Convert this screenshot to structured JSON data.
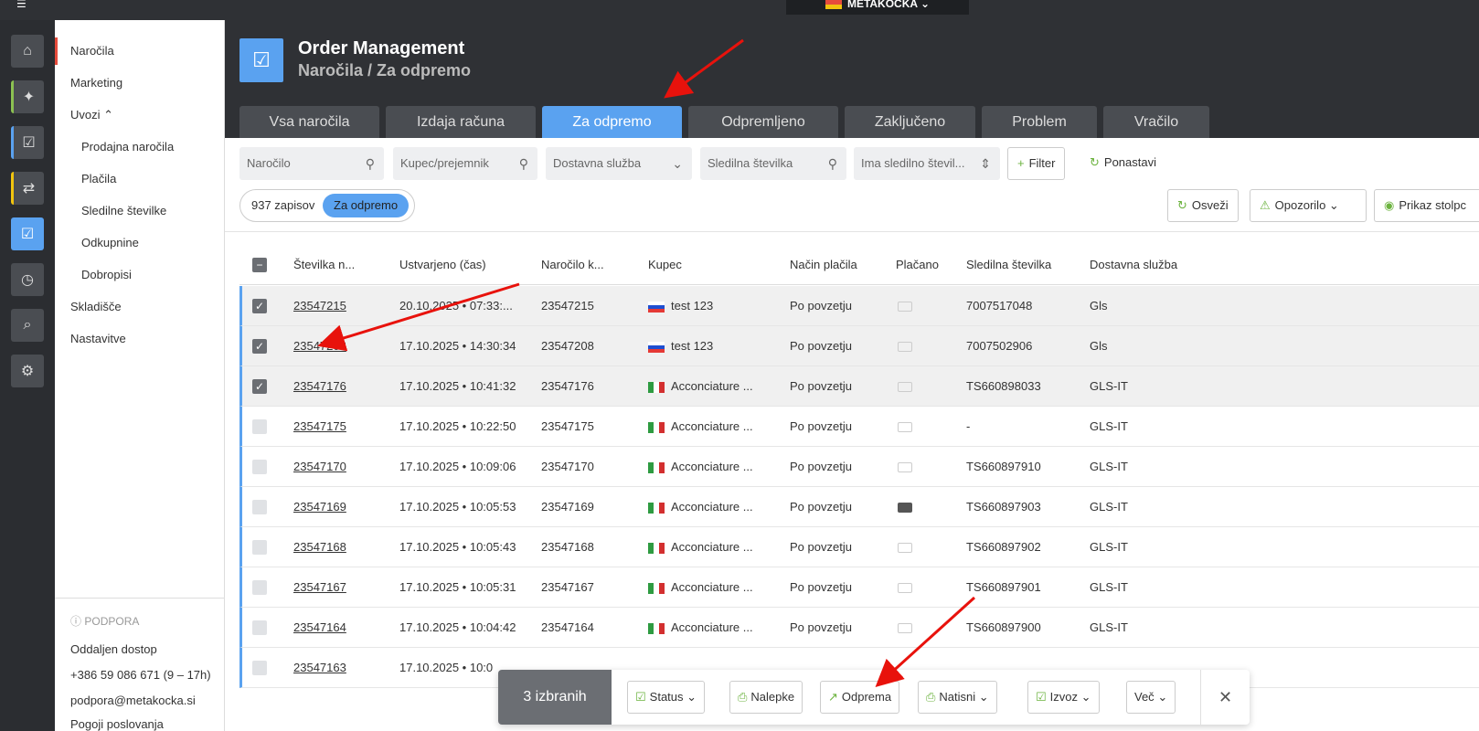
{
  "brand": {
    "name": "METAKOCKA"
  },
  "nav": {
    "items": [
      {
        "label": "Naročila"
      },
      {
        "label": "Marketing"
      },
      {
        "label": "Uvozi"
      },
      {
        "label": "Prodajna naročila"
      },
      {
        "label": "Plačila"
      },
      {
        "label": "Sledilne številke"
      },
      {
        "label": "Odkupnine"
      },
      {
        "label": "Dobropisi"
      },
      {
        "label": "Skladišče"
      },
      {
        "label": "Nastavitve"
      }
    ],
    "support_title": "PODPORA",
    "support_lines": [
      "Oddaljen dostop",
      "+386 59 086 671 (9 – 17h)",
      "podpora@metakocka.si",
      "Pogoji poslovanja"
    ]
  },
  "header": {
    "title": "Order Management",
    "breadcrumb": "Naročila / Za odpremo"
  },
  "tabs": [
    {
      "label": "Vsa naročila"
    },
    {
      "label": "Izdaja računa"
    },
    {
      "label": "Za odpremo"
    },
    {
      "label": "Odpremljeno"
    },
    {
      "label": "Zaključeno"
    },
    {
      "label": "Problem"
    },
    {
      "label": "Vračilo"
    }
  ],
  "filters": {
    "order_placeholder": "Naročilo",
    "buyer_placeholder": "Kupec/prejemnik",
    "delivery_placeholder": "Dostavna služba",
    "tracking_placeholder": "Sledilna številka",
    "has_tracking_placeholder": "Ima sledilno števil...",
    "filter_label": "Filter",
    "reset_label": "Ponastavi"
  },
  "summary": {
    "count": "937 zapisov",
    "badge": "Za odpremo"
  },
  "actions": {
    "refresh": "Osveži",
    "warning": "Opozorilo",
    "columns": "Prikaz stolpc"
  },
  "table": {
    "headers": [
      "Številka n...",
      "Ustvarjeno (čas)",
      "Naročilo k...",
      "Kupec",
      "Način plačila",
      "Plačano",
      "Sledilna številka",
      "Dostavna služba"
    ],
    "rows": [
      {
        "number": "23547215",
        "created": "20.10.2025 • 07:33:...",
        "order": "23547215",
        "buyer": "test 123",
        "payment": "Po povzetju",
        "tracking": "7007517048",
        "delivery": "Gls"
      },
      {
        "number": "23547208",
        "created": "17.10.2025 • 14:30:34",
        "order": "23547208",
        "buyer": "test 123",
        "payment": "Po povzetju",
        "tracking": "7007502906",
        "delivery": "Gls"
      },
      {
        "number": "23547176",
        "created": "17.10.2025 • 10:41:32",
        "order": "23547176",
        "buyer": "Acconciature ...",
        "payment": "Po povzetju",
        "tracking": "TS660898033",
        "delivery": "GLS-IT"
      },
      {
        "number": "23547175",
        "created": "17.10.2025 • 10:22:50",
        "order": "23547175",
        "buyer": "Acconciature ...",
        "payment": "Po povzetju",
        "tracking": "-",
        "delivery": "GLS-IT"
      },
      {
        "number": "23547170",
        "created": "17.10.2025 • 10:09:06",
        "order": "23547170",
        "buyer": "Acconciature ...",
        "payment": "Po povzetju",
        "tracking": "TS660897910",
        "delivery": "GLS-IT"
      },
      {
        "number": "23547169",
        "created": "17.10.2025 • 10:05:53",
        "order": "23547169",
        "buyer": "Acconciature ...",
        "payment": "Po povzetju",
        "tracking": "TS660897903",
        "delivery": "GLS-IT"
      },
      {
        "number": "23547168",
        "created": "17.10.2025 • 10:05:43",
        "order": "23547168",
        "buyer": "Acconciature ...",
        "payment": "Po povzetju",
        "tracking": "TS660897902",
        "delivery": "GLS-IT"
      },
      {
        "number": "23547167",
        "created": "17.10.2025 • 10:05:31",
        "order": "23547167",
        "buyer": "Acconciature ...",
        "payment": "Po povzetju",
        "tracking": "TS660897901",
        "delivery": "GLS-IT"
      },
      {
        "number": "23547164",
        "created": "17.10.2025 • 10:04:42",
        "order": "23547164",
        "buyer": "Acconciature ...",
        "payment": "Po povzetju",
        "tracking": "TS660897900",
        "delivery": "GLS-IT"
      },
      {
        "number": "23547163",
        "created": "17.10.2025 • 10:0",
        "order": "",
        "buyer": "",
        "payment": "",
        "tracking": "",
        "delivery": ""
      }
    ]
  },
  "bulk": {
    "selected": "3 izbranih",
    "status": "Status",
    "labels": "Nalepke",
    "shipping": "Odprema",
    "print": "Natisni",
    "export": "Izvoz",
    "more": "Več"
  }
}
